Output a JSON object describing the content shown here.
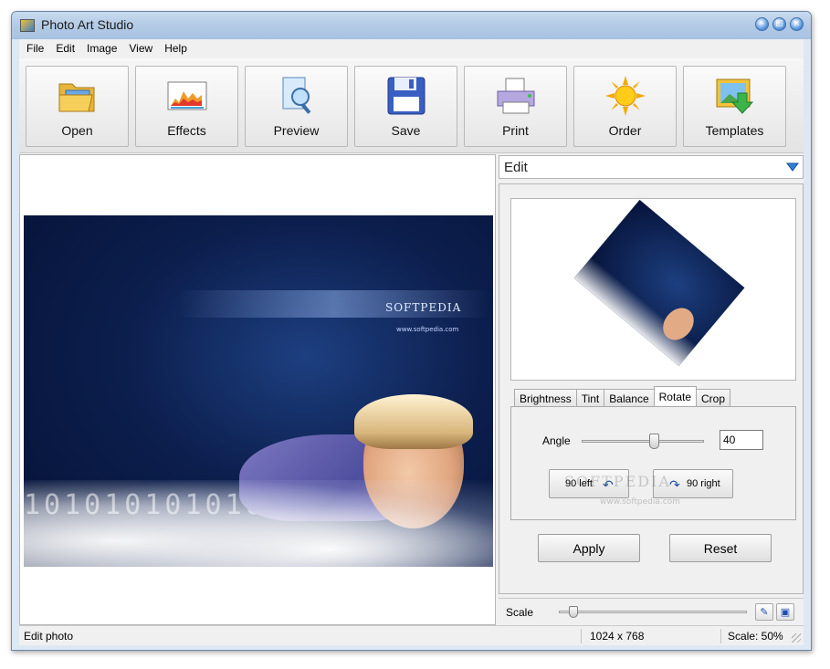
{
  "window": {
    "title": "Photo Art Studio"
  },
  "menu": [
    "File",
    "Edit",
    "Image",
    "View",
    "Help"
  ],
  "toolbar": [
    {
      "label": "Open",
      "icon": "folder-open-icon"
    },
    {
      "label": "Effects",
      "icon": "effects-chart-icon"
    },
    {
      "label": "Preview",
      "icon": "magnifier-page-icon"
    },
    {
      "label": "Save",
      "icon": "floppy-disk-icon"
    },
    {
      "label": "Print",
      "icon": "printer-icon"
    },
    {
      "label": "Order",
      "icon": "sun-icon"
    },
    {
      "label": "Templates",
      "icon": "template-download-icon"
    }
  ],
  "canvas": {
    "photo_brand": "SOFTPEDIA",
    "photo_url": "www.softpedia.com",
    "digits": "1010101010100"
  },
  "panel": {
    "mode": "Edit",
    "tabs": [
      "Brightness",
      "Tint",
      "Balance",
      "Rotate",
      "Crop"
    ],
    "active_tab": "Rotate",
    "angle_label": "Angle",
    "angle_value": "40",
    "rotate_left": "90 left",
    "rotate_right": "90 right",
    "apply": "Apply",
    "reset": "Reset",
    "scale_label": "Scale"
  },
  "status": {
    "message": "Edit photo",
    "dimensions": "1024 x 768",
    "scale": "Scale: 50%"
  },
  "watermark": {
    "text": "SOFTPEDIA",
    "url": "www.softpedia.com"
  },
  "colors": {
    "title_gradient": "#b3cbe6",
    "accent_blue": "#1c4ea8",
    "photo_bg": "#0c1e4d"
  }
}
